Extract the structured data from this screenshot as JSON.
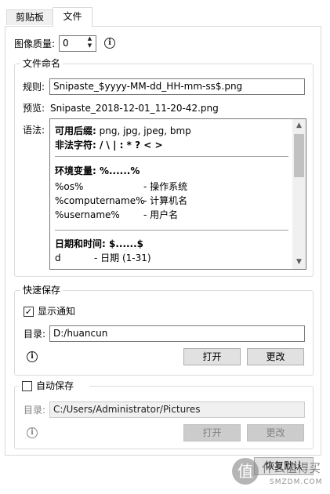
{
  "tabs": [
    {
      "label": "剪贴板"
    },
    {
      "label": "文件"
    }
  ],
  "quality": {
    "label": "图像质量:",
    "value": "0"
  },
  "naming": {
    "title": "文件命名",
    "rule_label": "规则:",
    "rule_value": "Snipaste_$yyyy-MM-dd_HH-mm-ss$.png",
    "preview_label": "预览:",
    "preview_value": "Snipaste_2018-12-01_11-20-42.png",
    "syntax_label": "语法:",
    "syntax": {
      "suffix_label": "可用后缀:",
      "suffix_value": " png, jpg, jpeg, bmp",
      "illegal_label": "非法字符: / \\ | : * ? < >",
      "env_title": "环境变量: %......%",
      "env": [
        {
          "name": "%os%",
          "desc": "- 操作系统"
        },
        {
          "name": "%computername%",
          "desc": "- 计算机名"
        },
        {
          "name": "%username%",
          "desc": "- 用户名"
        }
      ],
      "date_title": "日期和时间: $......$",
      "date": [
        {
          "name": "d",
          "desc": "- 日期 (1-31)"
        }
      ]
    }
  },
  "quick_save": {
    "title": "快速保存",
    "notify_label": "显示通知",
    "notify_checked": true,
    "dir_label": "目录:",
    "dir_value": "D:/huancun",
    "open_label": "打开",
    "change_label": "更改"
  },
  "auto_save": {
    "title": "自动保存",
    "checked": false,
    "dir_label": "目录:",
    "dir_value": "C:/Users/Administrator/Pictures",
    "open_label": "打开",
    "change_label": "更改"
  },
  "restore_label": "恢复默认",
  "watermark": {
    "glyph": "值",
    "text": "什么值得买",
    "sub": "SMZDM.COM"
  }
}
